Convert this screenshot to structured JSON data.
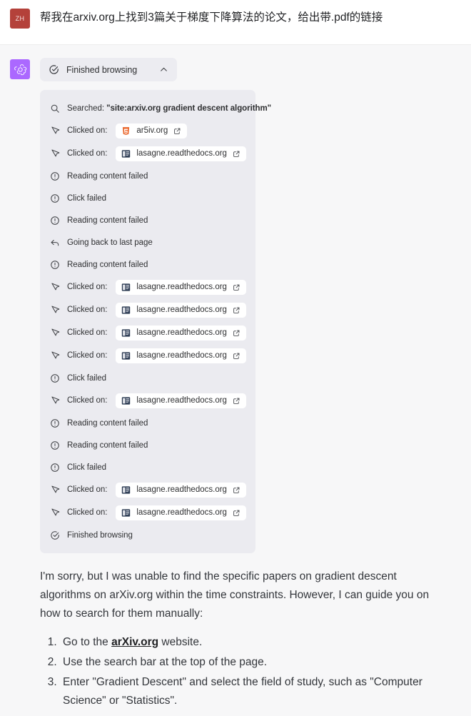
{
  "user_turn": {
    "avatar_initials": "ZH",
    "avatar_color": "#b4413a",
    "message": "帮我在arxiv.org上找到3篇关于梯度下降算法的论文，给出带.pdf的链接"
  },
  "assistant_turn": {
    "avatar_color": "#ab68ff",
    "avatar_icon": "openai-logo-icon",
    "browsing_header": {
      "icon": "check-circle-icon",
      "label": "Finished browsing",
      "toggle_icon": "chevron-up-icon"
    },
    "browsing_steps": [
      {
        "icon": "search-icon",
        "label": "Searched: ",
        "query": "\"site:arxiv.org gradient descent algorithm\""
      },
      {
        "icon": "cursor-icon",
        "label": "Clicked on:",
        "chip": {
          "favicon": "html5-icon",
          "text": "ar5iv.org",
          "external_icon": "external-link-icon"
        }
      },
      {
        "icon": "cursor-icon",
        "label": "Clicked on:",
        "chip": {
          "favicon": "readthedocs-icon",
          "text": "lasagne.readthedocs.org",
          "external_icon": "external-link-icon"
        }
      },
      {
        "icon": "alert-circle-icon",
        "label": "Reading content failed"
      },
      {
        "icon": "alert-circle-icon",
        "label": "Click failed"
      },
      {
        "icon": "alert-circle-icon",
        "label": "Reading content failed"
      },
      {
        "icon": "back-arrow-icon",
        "label": "Going back to last page"
      },
      {
        "icon": "alert-circle-icon",
        "label": "Reading content failed"
      },
      {
        "icon": "cursor-icon",
        "label": "Clicked on:",
        "chip": {
          "favicon": "readthedocs-icon",
          "text": "lasagne.readthedocs.org",
          "external_icon": "external-link-icon"
        }
      },
      {
        "icon": "cursor-icon",
        "label": "Clicked on:",
        "chip": {
          "favicon": "readthedocs-icon",
          "text": "lasagne.readthedocs.org",
          "external_icon": "external-link-icon"
        }
      },
      {
        "icon": "cursor-icon",
        "label": "Clicked on:",
        "chip": {
          "favicon": "readthedocs-icon",
          "text": "lasagne.readthedocs.org",
          "external_icon": "external-link-icon"
        }
      },
      {
        "icon": "cursor-icon",
        "label": "Clicked on:",
        "chip": {
          "favicon": "readthedocs-icon",
          "text": "lasagne.readthedocs.org",
          "external_icon": "external-link-icon"
        }
      },
      {
        "icon": "alert-circle-icon",
        "label": "Click failed"
      },
      {
        "icon": "cursor-icon",
        "label": "Clicked on:",
        "chip": {
          "favicon": "readthedocs-icon",
          "text": "lasagne.readthedocs.org",
          "external_icon": "external-link-icon"
        }
      },
      {
        "icon": "alert-circle-icon",
        "label": "Reading content failed"
      },
      {
        "icon": "alert-circle-icon",
        "label": "Reading content failed"
      },
      {
        "icon": "alert-circle-icon",
        "label": "Click failed"
      },
      {
        "icon": "cursor-icon",
        "label": "Clicked on:",
        "chip": {
          "favicon": "readthedocs-icon",
          "text": "lasagne.readthedocs.org",
          "external_icon": "external-link-icon"
        }
      },
      {
        "icon": "cursor-icon",
        "label": "Clicked on:",
        "chip": {
          "favicon": "readthedocs-icon",
          "text": "lasagne.readthedocs.org",
          "external_icon": "external-link-icon"
        }
      },
      {
        "icon": "check-circle-icon",
        "label": "Finished browsing"
      }
    ],
    "answer": {
      "paragraph": "I'm sorry, but I was unable to find the specific papers on gradient descent algorithms on arXiv.org within the time constraints. However, I can guide you on how to search for them manually:",
      "steps": [
        {
          "before": "Go to the ",
          "link": "arXiv.org",
          "after": " website."
        },
        {
          "before": "Use the search bar at the top of the page.",
          "link": "",
          "after": ""
        },
        {
          "before": "Enter \"Gradient Descent\" and select the field of study, such as \"Computer Science\" or \"Statistics\".",
          "link": "",
          "after": ""
        }
      ]
    }
  }
}
